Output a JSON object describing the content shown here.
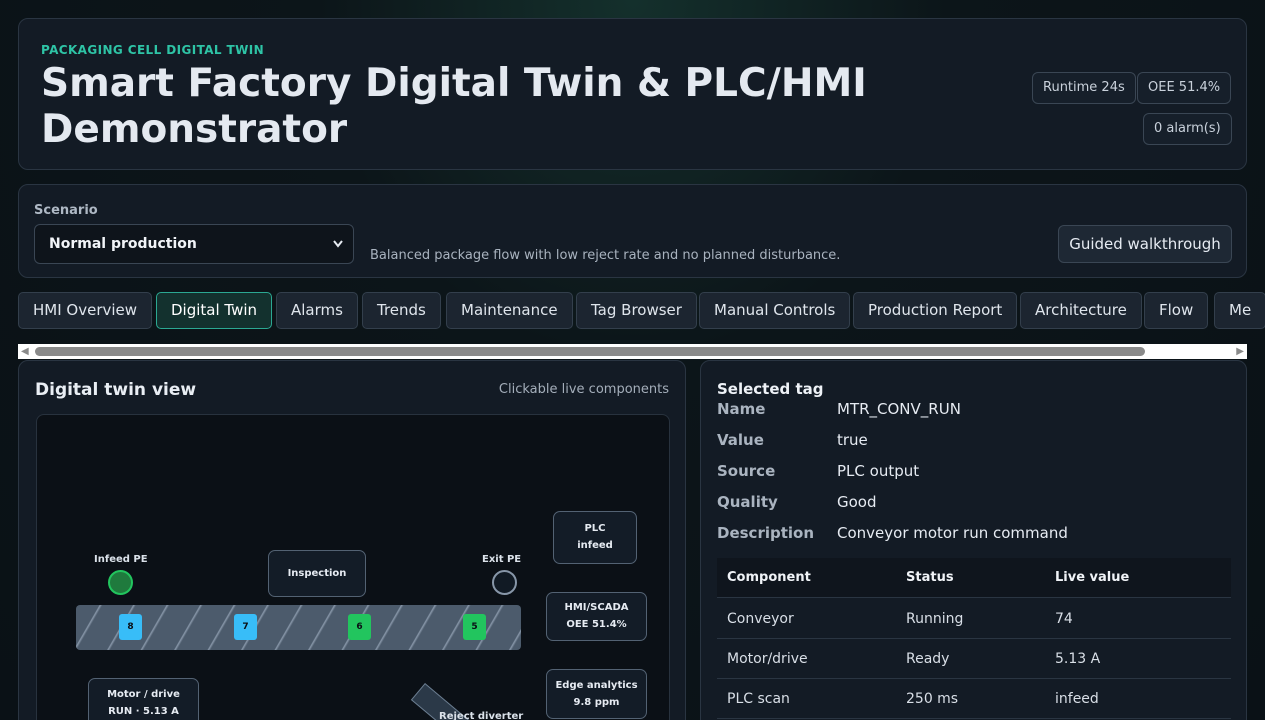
{
  "header": {
    "kicker": "PACKAGING CELL DIGITAL TWIN",
    "title": "Smart Factory Digital Twin & PLC/HMI Demonstrator",
    "runtime": "Runtime 24s",
    "oee": "OEE 51.4%",
    "alarms": "0 alarm(s)"
  },
  "scenario": {
    "label": "Scenario",
    "selected": "Normal production",
    "description": "Balanced package flow with low reject rate and no planned disturbance.",
    "guided_button": "Guided walkthrough"
  },
  "tabs": [
    {
      "label": "HMI Overview"
    },
    {
      "label": "Digital Twin"
    },
    {
      "label": "Alarms"
    },
    {
      "label": "Trends"
    },
    {
      "label": "Maintenance"
    },
    {
      "label": "Tag Browser"
    },
    {
      "label": "Manual Controls"
    },
    {
      "label": "Production Report"
    },
    {
      "label": "Architecture"
    },
    {
      "label": "Flow"
    },
    {
      "label": "Me"
    }
  ],
  "twin": {
    "title": "Digital twin view",
    "hint": "Clickable live components",
    "plc_line1": "PLC",
    "plc_line2": "infeed",
    "infeed_label": "Infeed PE",
    "exit_label": "Exit PE",
    "inspection_label": "Inspection",
    "hmi_line1": "HMI/SCADA",
    "hmi_line2": "OEE 51.4%",
    "edge_line1": "Edge analytics",
    "edge_line2": "9.8 ppm",
    "motor_line1": "Motor / drive",
    "motor_line2": "RUN · 5.13 A",
    "diverter_label": "Reject diverter",
    "packages": [
      {
        "id": "8",
        "color": "#38bdf8"
      },
      {
        "id": "7",
        "color": "#38bdf8"
      },
      {
        "id": "6",
        "color": "#22c55e"
      },
      {
        "id": "5",
        "color": "#22c55e"
      }
    ],
    "colors": {
      "infeed_sensor": "#1f7a3d",
      "exit_sensor": "#111a24"
    }
  },
  "tag": {
    "title": "Selected tag",
    "fields": [
      {
        "key": "Name",
        "value": "MTR_CONV_RUN"
      },
      {
        "key": "Value",
        "value": "true"
      },
      {
        "key": "Source",
        "value": "PLC output"
      },
      {
        "key": "Quality",
        "value": "Good"
      },
      {
        "key": "Description",
        "value": "Conveyor motor run command"
      }
    ],
    "table": {
      "headers": [
        "Component",
        "Status",
        "Live value"
      ],
      "rows": [
        [
          "Conveyor",
          "Running",
          "74"
        ],
        [
          "Motor/drive",
          "Ready",
          "5.13 A"
        ],
        [
          "PLC scan",
          "250 ms",
          "infeed"
        ]
      ]
    }
  }
}
